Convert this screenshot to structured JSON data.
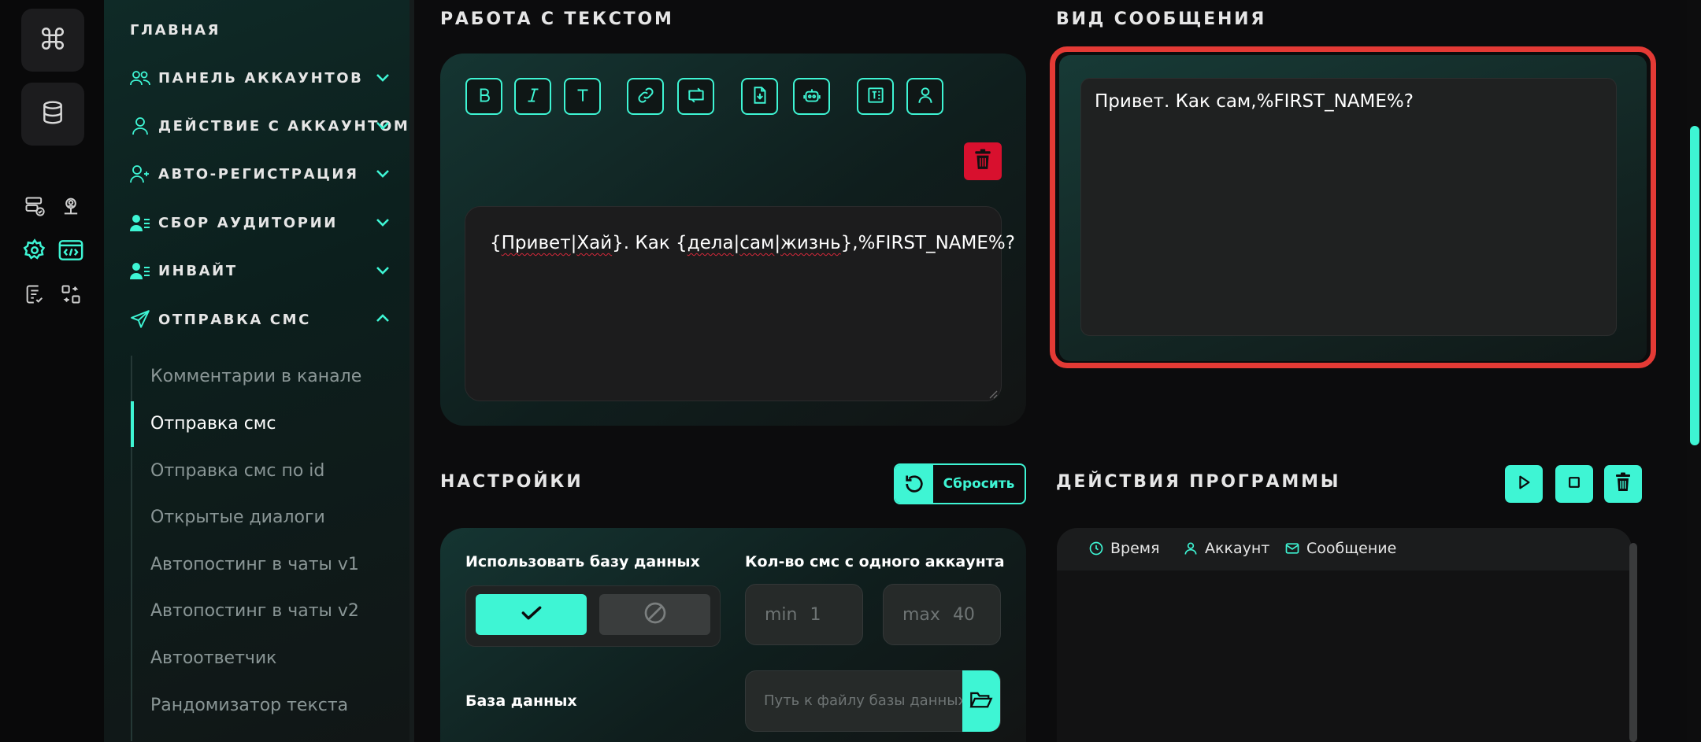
{
  "sidebar": {
    "main_label": "ГЛАВНАЯ",
    "sections": [
      {
        "label": "ПАНЕЛЬ АККАУНТОВ",
        "icon": "users-icon",
        "expanded": false
      },
      {
        "label": "ДЕЙСТВИЕ С АККАУНТОМ",
        "icon": "user-icon",
        "expanded": false
      },
      {
        "label": "АВТО-РЕГИСТРАЦИЯ",
        "icon": "user-plus-icon",
        "expanded": false
      },
      {
        "label": "СБОР АУДИТОРИИ",
        "icon": "user-list-icon",
        "expanded": false
      },
      {
        "label": "ИНВАЙТ",
        "icon": "user-list-icon",
        "expanded": false
      },
      {
        "label": "ОТПРАВКА СМС",
        "icon": "paper-plane-icon",
        "expanded": true
      }
    ],
    "sub_items": [
      "Комментарии в канале",
      "Отправка смс",
      "Отправка смс по id",
      "Открытые диалоги",
      "Автопостинг в чаты v1",
      "Автопостинг в чаты v2",
      "Автоответчик",
      "Рандомизатор текста"
    ],
    "active_sub_item": "Отправка смс"
  },
  "text_panel": {
    "title": "РАБОТА С ТЕКСТОМ",
    "toolbar": [
      "bold-icon",
      "italic-icon",
      "text-icon",
      "link-icon",
      "repeat-icon",
      "file-import-icon",
      "bot-icon",
      "text-format-icon",
      "person-icon"
    ],
    "editor_text": {
      "brace1_open": "{",
      "word1": "Привет",
      "pipe1": "|",
      "word2": "Хай",
      "brace1_close": "}",
      "mid": ". Как {",
      "word3": "дела",
      "pipe2": "|",
      "word4": "сам",
      "pipe3": "|",
      "word5": "жизнь",
      "tail": "},%FIRST_NAME%?"
    }
  },
  "preview": {
    "title": "ВИД СООБЩЕНИЯ",
    "text": "Привет. Как сам,%FIRST_NAME%?"
  },
  "settings": {
    "title": "НАСТРОЙКИ",
    "reset_label": "Сбросить",
    "use_db_label": "Использовать базу данных",
    "use_db_value": true,
    "count_label": "Кол-во смс с одного аккаунта",
    "min_label": "min",
    "min_value": "1",
    "max_label": "max",
    "max_value": "40",
    "db_label": "База данных",
    "db_placeholder": "Путь к файлу базы данных"
  },
  "actions": {
    "title": "ДЕЙСТВИЯ ПРОГРАММЫ",
    "columns": [
      {
        "label": "Время",
        "icon": "clock-icon"
      },
      {
        "label": "Аккаунт",
        "icon": "user-icon"
      },
      {
        "label": "Сообщение",
        "icon": "mail-icon"
      }
    ]
  },
  "colors": {
    "accent": "#3ef5d4",
    "danger": "#d8102e",
    "highlight": "#e43a35"
  }
}
